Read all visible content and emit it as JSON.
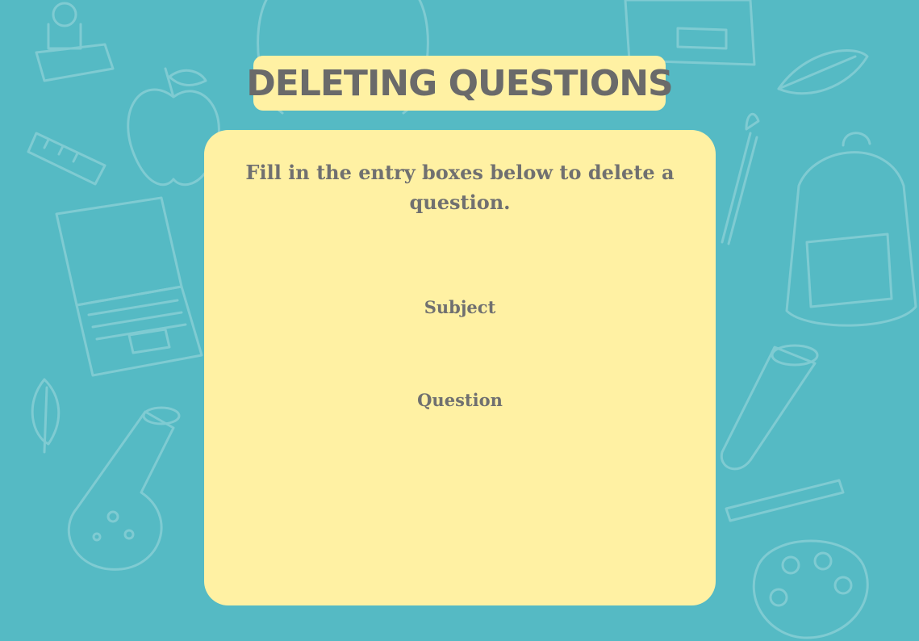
{
  "page": {
    "title": "DELETING QUESTIONS",
    "instructions": "Fill in the entry boxes below to delete a question."
  },
  "form": {
    "subject_label": "Subject",
    "question_label": "Question"
  },
  "colors": {
    "background": "#55bac4",
    "panel": "#fff1a3",
    "text": "#707070",
    "doodle": "#7fcbd2"
  },
  "background_icons": [
    "stamp-icon",
    "apple-icon",
    "ruler-icon",
    "laptop-icon",
    "flask-icon",
    "backpack-icon",
    "leaf-icon",
    "paintbrush-icon",
    "test-tube-icon",
    "palette-icon",
    "pen-icon"
  ]
}
